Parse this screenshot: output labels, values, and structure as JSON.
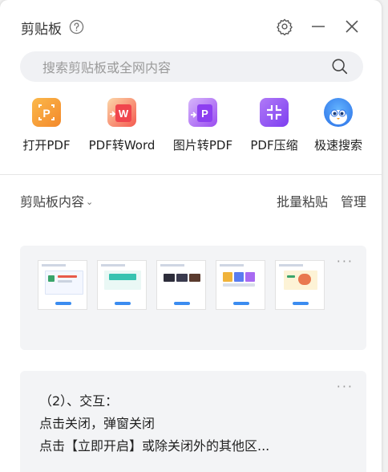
{
  "header": {
    "title": "剪贴板"
  },
  "search": {
    "placeholder": "搜索剪贴板或全网内容"
  },
  "tools": [
    {
      "label": "打开PDF",
      "icon": "open-pdf-icon",
      "color": "#f7a23b"
    },
    {
      "label": "PDF转Word",
      "icon": "pdf-to-word-icon",
      "color": "#f2555a"
    },
    {
      "label": "图片转PDF",
      "icon": "image-to-pdf-icon",
      "color": "#a35af1"
    },
    {
      "label": "PDF压缩",
      "icon": "pdf-compress-icon",
      "color": "#8f4cf0"
    },
    {
      "label": "极速搜索",
      "icon": "fast-search-icon",
      "color": "#3a8df5"
    }
  ],
  "section": {
    "title": "剪贴板内容",
    "batch_paste": "批量粘贴",
    "manage": "管理"
  },
  "cards": [
    {
      "type": "images",
      "more": "···"
    },
    {
      "type": "text",
      "more": "···",
      "lines": [
        "（2）、交互：",
        "点击关闭，弹窗关闭",
        "点击【立即开启】或除关闭外的其他区..."
      ]
    }
  ]
}
